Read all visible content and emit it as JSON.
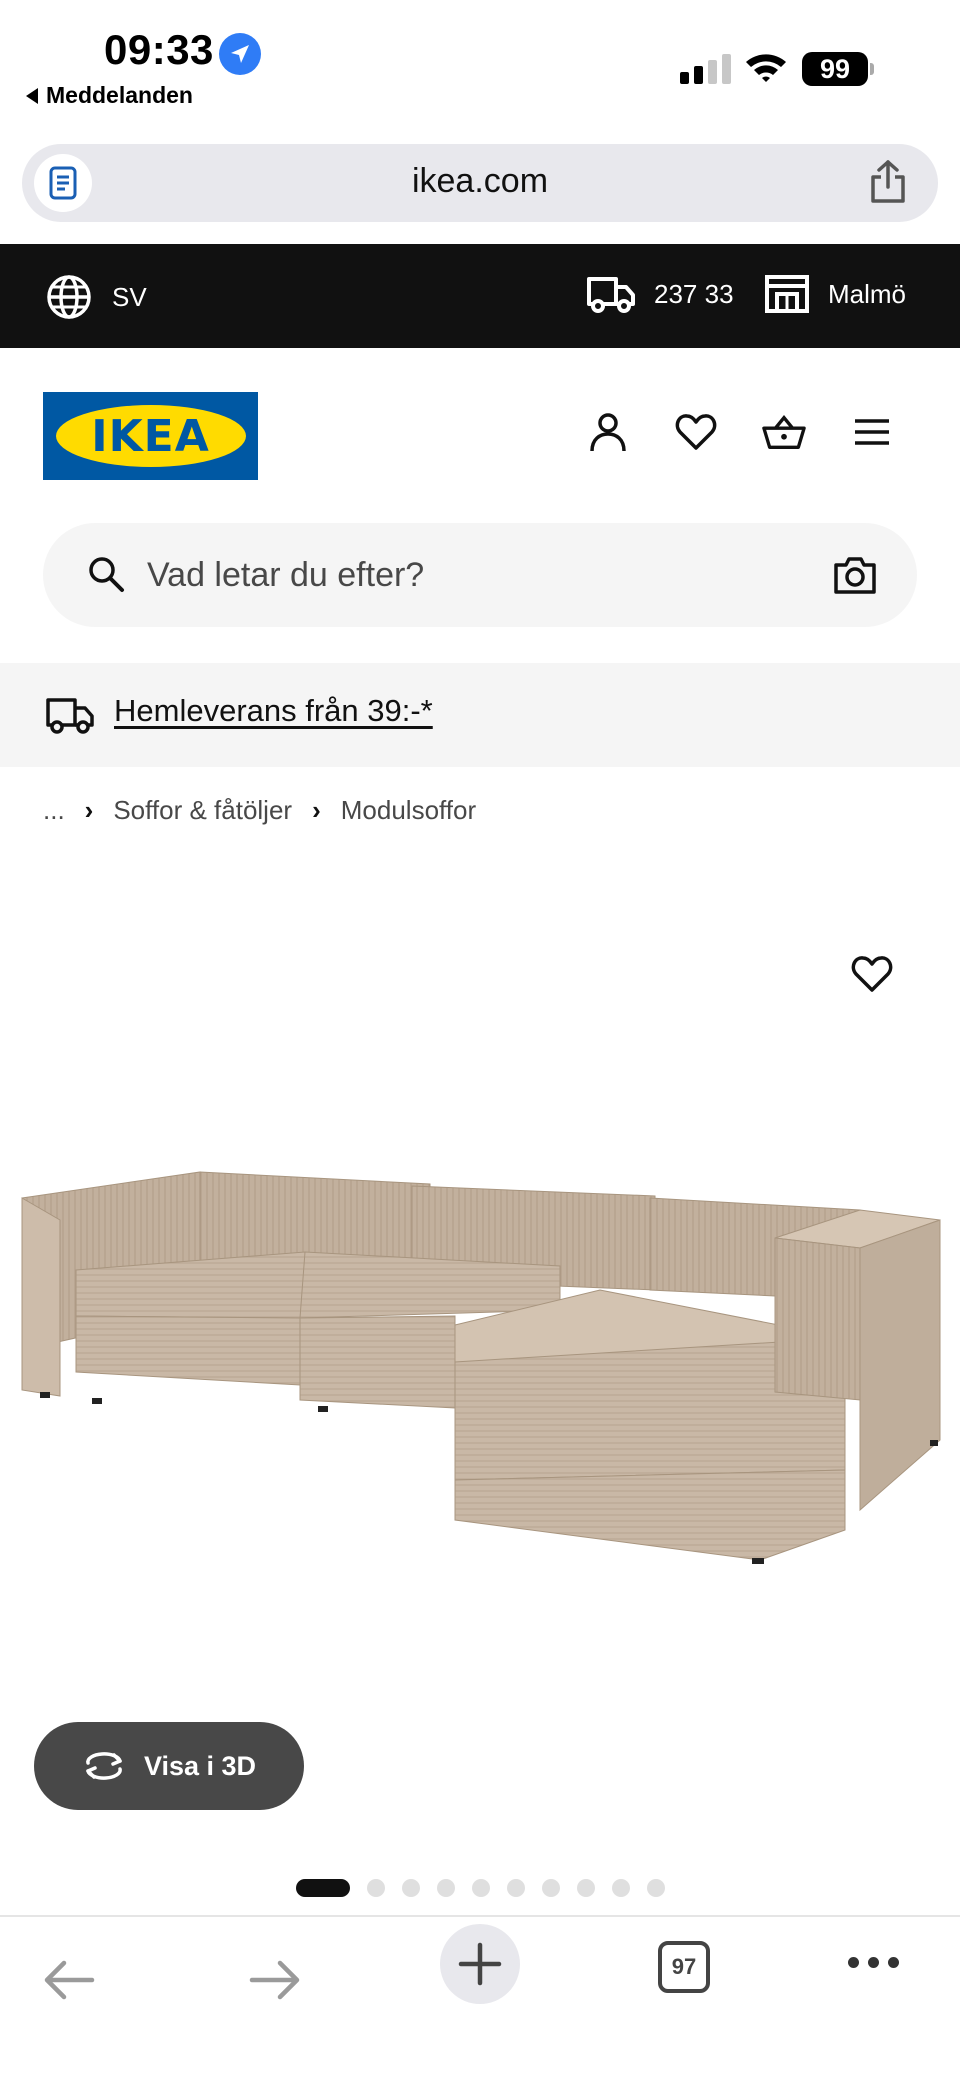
{
  "status_bar": {
    "time": "09:33",
    "back_app": "Meddelanden",
    "battery": "99"
  },
  "browser": {
    "url": "ikea.com",
    "tab_count": "97"
  },
  "topbar": {
    "language": "SV",
    "zip": "237 33",
    "store": "Malmö"
  },
  "header": {
    "logo_text": "IKEA",
    "icons": [
      "user-icon",
      "heart-icon",
      "basket-icon",
      "menu-icon"
    ]
  },
  "search": {
    "placeholder": "Vad letar du efter?"
  },
  "banner": {
    "text": "Hemleverans från 39:-*"
  },
  "breadcrumb": {
    "items": [
      "...",
      "Soffor & fåtöljer",
      "Modulsoffor"
    ]
  },
  "product": {
    "view_3d_label": "Visa i 3D",
    "image_count": 10,
    "active_image": 1
  },
  "colors": {
    "ikea_blue": "#0058a3",
    "ikea_yellow": "#ffdb00",
    "topbar_bg": "#111111",
    "button_3d_bg": "#484848"
  }
}
